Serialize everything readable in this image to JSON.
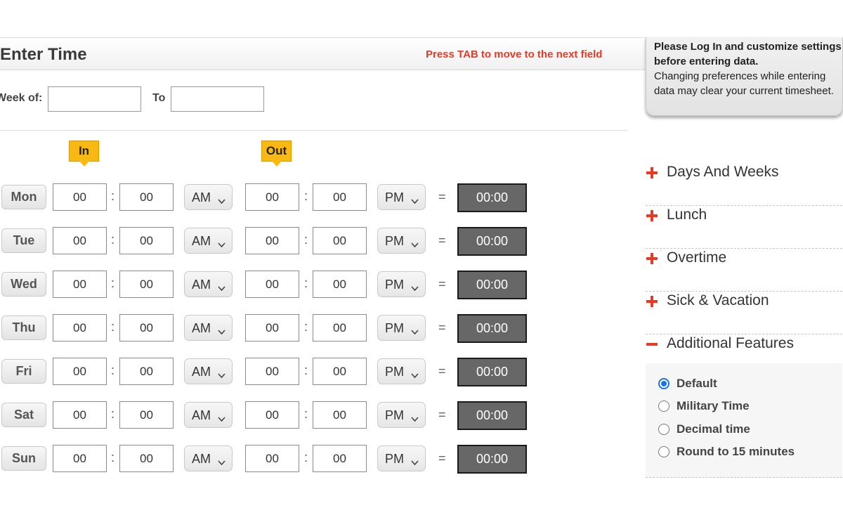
{
  "header": {
    "title": "Enter Time",
    "tab_hint": "Press TAB to move to the next field"
  },
  "week": {
    "week_of_label": "Week of:",
    "to_label": "To",
    "week_of_value": "",
    "to_value": ""
  },
  "columns": {
    "in_label": "In",
    "out_label": "Out"
  },
  "separator": ":",
  "equals": "=",
  "days": [
    {
      "label": "Mon",
      "in_hour": "00",
      "in_min": "00",
      "in_ampm": "AM",
      "out_hour": "00",
      "out_min": "00",
      "out_ampm": "PM",
      "total": "00:00"
    },
    {
      "label": "Tue",
      "in_hour": "00",
      "in_min": "00",
      "in_ampm": "AM",
      "out_hour": "00",
      "out_min": "00",
      "out_ampm": "PM",
      "total": "00:00"
    },
    {
      "label": "Wed",
      "in_hour": "00",
      "in_min": "00",
      "in_ampm": "AM",
      "out_hour": "00",
      "out_min": "00",
      "out_ampm": "PM",
      "total": "00:00"
    },
    {
      "label": "Thu",
      "in_hour": "00",
      "in_min": "00",
      "in_ampm": "AM",
      "out_hour": "00",
      "out_min": "00",
      "out_ampm": "PM",
      "total": "00:00"
    },
    {
      "label": "Fri",
      "in_hour": "00",
      "in_min": "00",
      "in_ampm": "AM",
      "out_hour": "00",
      "out_min": "00",
      "out_ampm": "PM",
      "total": "00:00"
    },
    {
      "label": "Sat",
      "in_hour": "00",
      "in_min": "00",
      "in_ampm": "AM",
      "out_hour": "00",
      "out_min": "00",
      "out_ampm": "PM",
      "total": "00:00"
    },
    {
      "label": "Sun",
      "in_hour": "00",
      "in_min": "00",
      "in_ampm": "AM",
      "out_hour": "00",
      "out_min": "00",
      "out_ampm": "PM",
      "total": "00:00"
    }
  ],
  "notice": {
    "bold_text": "Please Log In and customize settings before entering data.",
    "text": "Changing preferences while entering data may clear your current timesheet."
  },
  "sidebar": {
    "sections": [
      {
        "label": "Days And Weeks",
        "icon": "plus-icon",
        "expanded": false
      },
      {
        "label": "Lunch",
        "icon": "plus-icon",
        "expanded": false
      },
      {
        "label": "Overtime",
        "icon": "plus-icon",
        "expanded": false
      },
      {
        "label": "Sick & Vacation",
        "icon": "plus-icon",
        "expanded": false
      },
      {
        "label": "Additional Features",
        "icon": "minus-icon",
        "expanded": true
      }
    ],
    "feature_options": [
      {
        "label": "Default",
        "checked": true
      },
      {
        "label": "Military Time",
        "checked": false
      },
      {
        "label": "Decimal time",
        "checked": false
      },
      {
        "label": "Round to 15 minutes",
        "checked": false
      }
    ]
  },
  "colors": {
    "accent_red": "#e53b26",
    "tag_yellow": "#f9b915",
    "total_bg": "#676767",
    "radio_blue": "#1a73e8"
  }
}
